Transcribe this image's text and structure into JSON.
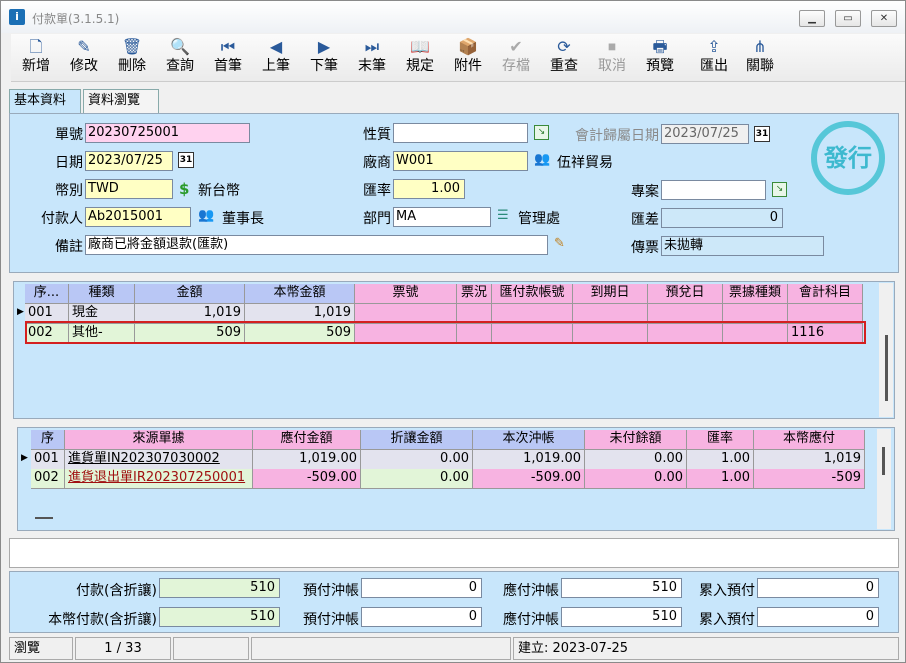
{
  "window": {
    "title": "付款單(3.1.5.1)"
  },
  "toolbar": [
    {
      "label": "新增",
      "icon": "new-doc-icon",
      "glyph": "🗋",
      "disabled": false
    },
    {
      "label": "修改",
      "icon": "edit-icon",
      "glyph": "✎",
      "disabled": false
    },
    {
      "label": "刪除",
      "icon": "trash-icon",
      "glyph": "🗑",
      "disabled": false
    },
    {
      "label": "查詢",
      "icon": "search-icon",
      "glyph": "🔍",
      "disabled": false
    },
    {
      "label": "首筆",
      "icon": "first-icon",
      "glyph": "⏮",
      "disabled": false
    },
    {
      "label": "上筆",
      "icon": "prev-icon",
      "glyph": "◀",
      "disabled": false
    },
    {
      "label": "下筆",
      "icon": "next-icon",
      "glyph": "▶",
      "disabled": false
    },
    {
      "label": "末筆",
      "icon": "last-icon",
      "glyph": "⏭",
      "disabled": false
    },
    {
      "label": "規定",
      "icon": "book-icon",
      "glyph": "📖",
      "disabled": false
    },
    {
      "label": "附件",
      "icon": "attachment-icon",
      "glyph": "📦",
      "disabled": false
    },
    {
      "label": "存檔",
      "icon": "save-icon",
      "glyph": "✔",
      "disabled": true
    },
    {
      "label": "重查",
      "icon": "refresh-icon",
      "glyph": "⟳",
      "disabled": false
    },
    {
      "label": "取消",
      "icon": "cancel-icon",
      "glyph": "⏹",
      "disabled": true
    },
    {
      "label": "預覽",
      "icon": "print-preview-icon",
      "glyph": "🖶",
      "disabled": false
    },
    {
      "label": "匯出",
      "icon": "export-icon",
      "glyph": "⇪",
      "disabled": false
    },
    {
      "label": "關聯",
      "icon": "relation-icon",
      "glyph": "⋔",
      "disabled": false
    }
  ],
  "tabs": {
    "basic": "基本資料",
    "browse": "資料瀏覽"
  },
  "form": {
    "doc_no_label": "單號",
    "doc_no": "20230725001",
    "date_label": "日期",
    "date": "2023/07/25",
    "currency_label": "幣別",
    "currency": "TWD",
    "currency_name": "新台幣",
    "payer_label": "付款人",
    "payer": "Ab2015001",
    "payer_name": "董事長",
    "remark_label": "備註",
    "remark": "廠商已將金額退款(匯款)",
    "nature_label": "性質",
    "nature": "",
    "vendor_label": "廠商",
    "vendor": "W001",
    "vendor_name": "伍祥貿易",
    "rate_label": "匯率",
    "rate": "1.00",
    "dept_label": "部門",
    "dept": "MA",
    "dept_name": "管理處",
    "acct_date_label": "會計歸屬日期",
    "acct_date": "2023/07/25",
    "project_label": "專案",
    "project": "",
    "rate_diff_label": "匯差",
    "rate_diff": "0",
    "voucher_label": "傳票",
    "voucher": "未拋轉",
    "calendar_badge": "31",
    "stamp": "發行"
  },
  "grid1": {
    "headers": [
      "序...",
      "種類",
      "金額",
      "本幣金額",
      "票號",
      "票況",
      "匯付款帳號",
      "到期日",
      "預兌日",
      "票據種類",
      "會計科目"
    ],
    "rows": [
      [
        "001",
        "現金",
        "1,019",
        "1,019",
        "",
        "",
        "",
        "",
        "",
        "",
        ""
      ],
      [
        "002",
        "其他-",
        "509",
        "509",
        "",
        "",
        "",
        "",
        "",
        "",
        "1116"
      ]
    ]
  },
  "grid2": {
    "headers": [
      "序",
      "來源單據",
      "應付金額",
      "折讓金額",
      "本次沖帳",
      "未付餘額",
      "匯率",
      "本幣應付"
    ],
    "rows": [
      [
        "001",
        "進貨單IN202307030002",
        "1,019.00",
        "0.00",
        "1,019.00",
        "0.00",
        "1.00",
        "1,019"
      ],
      [
        "002",
        "進貨退出單IR202307250001",
        "-509.00",
        "0.00",
        "-509.00",
        "0.00",
        "1.00",
        "-509"
      ]
    ]
  },
  "summary": {
    "pay_label": "付款(含折讓)",
    "pay": "510",
    "prepay_offset_label": "預付沖帳",
    "prepay_offset": "0",
    "ap_offset_label": "應付沖帳",
    "ap_offset": "510",
    "accum_prepay_label": "累入預付",
    "accum_prepay": "0",
    "local_pay_label": "本幣付款(含折讓)",
    "local_pay": "510",
    "local_prepay_offset_label": "預付沖帳",
    "local_prepay_offset": "0",
    "local_ap_offset_label": "應付沖帳",
    "local_ap_offset": "510",
    "local_accum_prepay_label": "累入預付",
    "local_accum_prepay": "0"
  },
  "status": {
    "mode": "瀏覽",
    "page": "1 / 33",
    "created": "建立: 2023-07-25"
  }
}
